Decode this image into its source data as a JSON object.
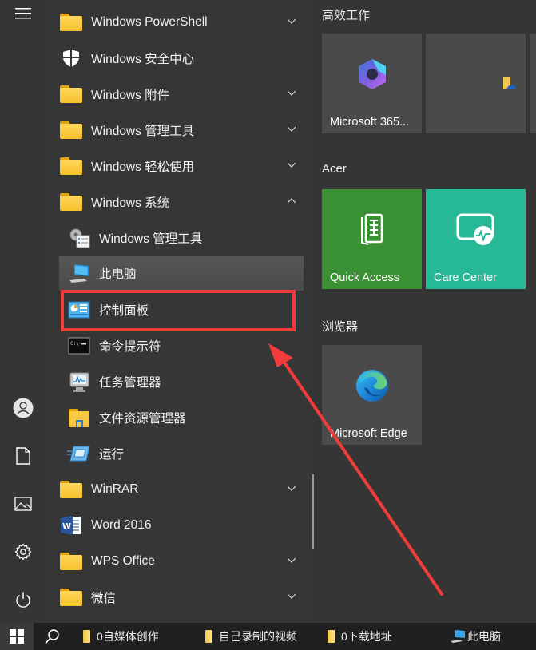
{
  "rail": {
    "icons": [
      "hamburger-menu-icon",
      "user-icon",
      "document-icon",
      "pictures-icon",
      "settings-icon",
      "power-icon"
    ]
  },
  "applist": {
    "items": [
      {
        "label": "Windows PowerShell",
        "icon": "folder-icon",
        "expandable": true,
        "expanded": false
      },
      {
        "label": "Windows 安全中心",
        "icon": "shield-icon",
        "expandable": false
      },
      {
        "label": "Windows 附件",
        "icon": "folder-icon",
        "expandable": true,
        "expanded": false
      },
      {
        "label": "Windows 管理工具",
        "icon": "folder-icon",
        "expandable": true,
        "expanded": false
      },
      {
        "label": "Windows 轻松使用",
        "icon": "folder-icon",
        "expandable": true,
        "expanded": false
      },
      {
        "label": "Windows 系统",
        "icon": "folder-icon",
        "expandable": true,
        "expanded": true
      },
      {
        "label": "Windows 管理工具",
        "icon": "admin-tools-icon",
        "sub": true
      },
      {
        "label": "此电脑",
        "icon": "computer-icon",
        "sub": true,
        "hover": true
      },
      {
        "label": "控制面板",
        "icon": "control-panel-icon",
        "sub": true,
        "highlighted": true
      },
      {
        "label": "命令提示符",
        "icon": "command-prompt-icon",
        "sub": true
      },
      {
        "label": "任务管理器",
        "icon": "task-manager-icon",
        "sub": true
      },
      {
        "label": "文件资源管理器",
        "icon": "file-explorer-icon",
        "sub": true
      },
      {
        "label": "运行",
        "icon": "run-icon",
        "sub": true
      },
      {
        "label": "WinRAR",
        "icon": "folder-icon",
        "expandable": true,
        "expanded": false
      },
      {
        "label": "Word 2016",
        "icon": "word-icon",
        "expandable": false
      },
      {
        "label": "WPS Office",
        "icon": "folder-icon",
        "expandable": true,
        "expanded": false
      },
      {
        "label": "微信",
        "icon": "folder-icon",
        "expandable": true,
        "expanded": false
      }
    ]
  },
  "tiles": {
    "groups": [
      {
        "title": "高效工作",
        "tiles": [
          {
            "label": "Microsoft 365...",
            "icon": "microsoft-365-icon",
            "color": "#4a4a4a"
          },
          {
            "label": "",
            "icon": "onedrive-folder-icon",
            "color": "#4a4a4a"
          }
        ]
      },
      {
        "title": "Acer",
        "tiles": [
          {
            "label": "Quick Access",
            "icon": "quick-access-icon",
            "color": "#3a9133"
          },
          {
            "label": "Care Center",
            "icon": "care-center-icon",
            "color": "#27b897"
          }
        ]
      },
      {
        "title": "浏览器",
        "tiles": [
          {
            "label": "Microsoft Edge",
            "icon": "edge-icon",
            "color": "#4a4a4a"
          }
        ]
      }
    ]
  },
  "taskbar": {
    "items": [
      {
        "label": "0自媒体创作",
        "icon": "folder-icon"
      },
      {
        "label": "自己录制的视频",
        "icon": "folder-icon"
      },
      {
        "label": "0下载地址",
        "icon": "folder-icon"
      },
      {
        "label": "此电脑",
        "icon": "computer-icon"
      }
    ]
  },
  "annotation": {
    "highlight_color": "#f23c3c",
    "target": "控制面板"
  }
}
